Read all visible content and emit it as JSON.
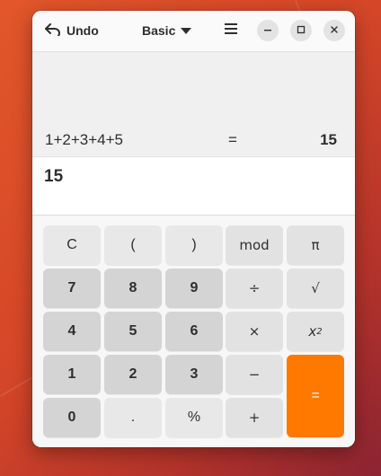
{
  "headerbar": {
    "undo_label": "Undo",
    "mode_label": "Basic"
  },
  "history": {
    "expression": "1+2+3+4+5",
    "equals": "=",
    "result": "15"
  },
  "display": {
    "entry": "15"
  },
  "keys": {
    "clear": "C",
    "open_paren": "(",
    "close_paren": ")",
    "mod": "mod",
    "pi": "π",
    "seven": "7",
    "eight": "8",
    "nine": "9",
    "divide": "÷",
    "sqrt": "√",
    "four": "4",
    "five": "5",
    "six": "6",
    "multiply": "×",
    "square_base": "x",
    "square_exp": "2",
    "one": "1",
    "two": "2",
    "three": "3",
    "subtract": "−",
    "equals": "=",
    "zero": "0",
    "decimal": ".",
    "percent": "%",
    "add": "+"
  },
  "colors": {
    "accent": "#ff7800",
    "background": "#d44628"
  }
}
